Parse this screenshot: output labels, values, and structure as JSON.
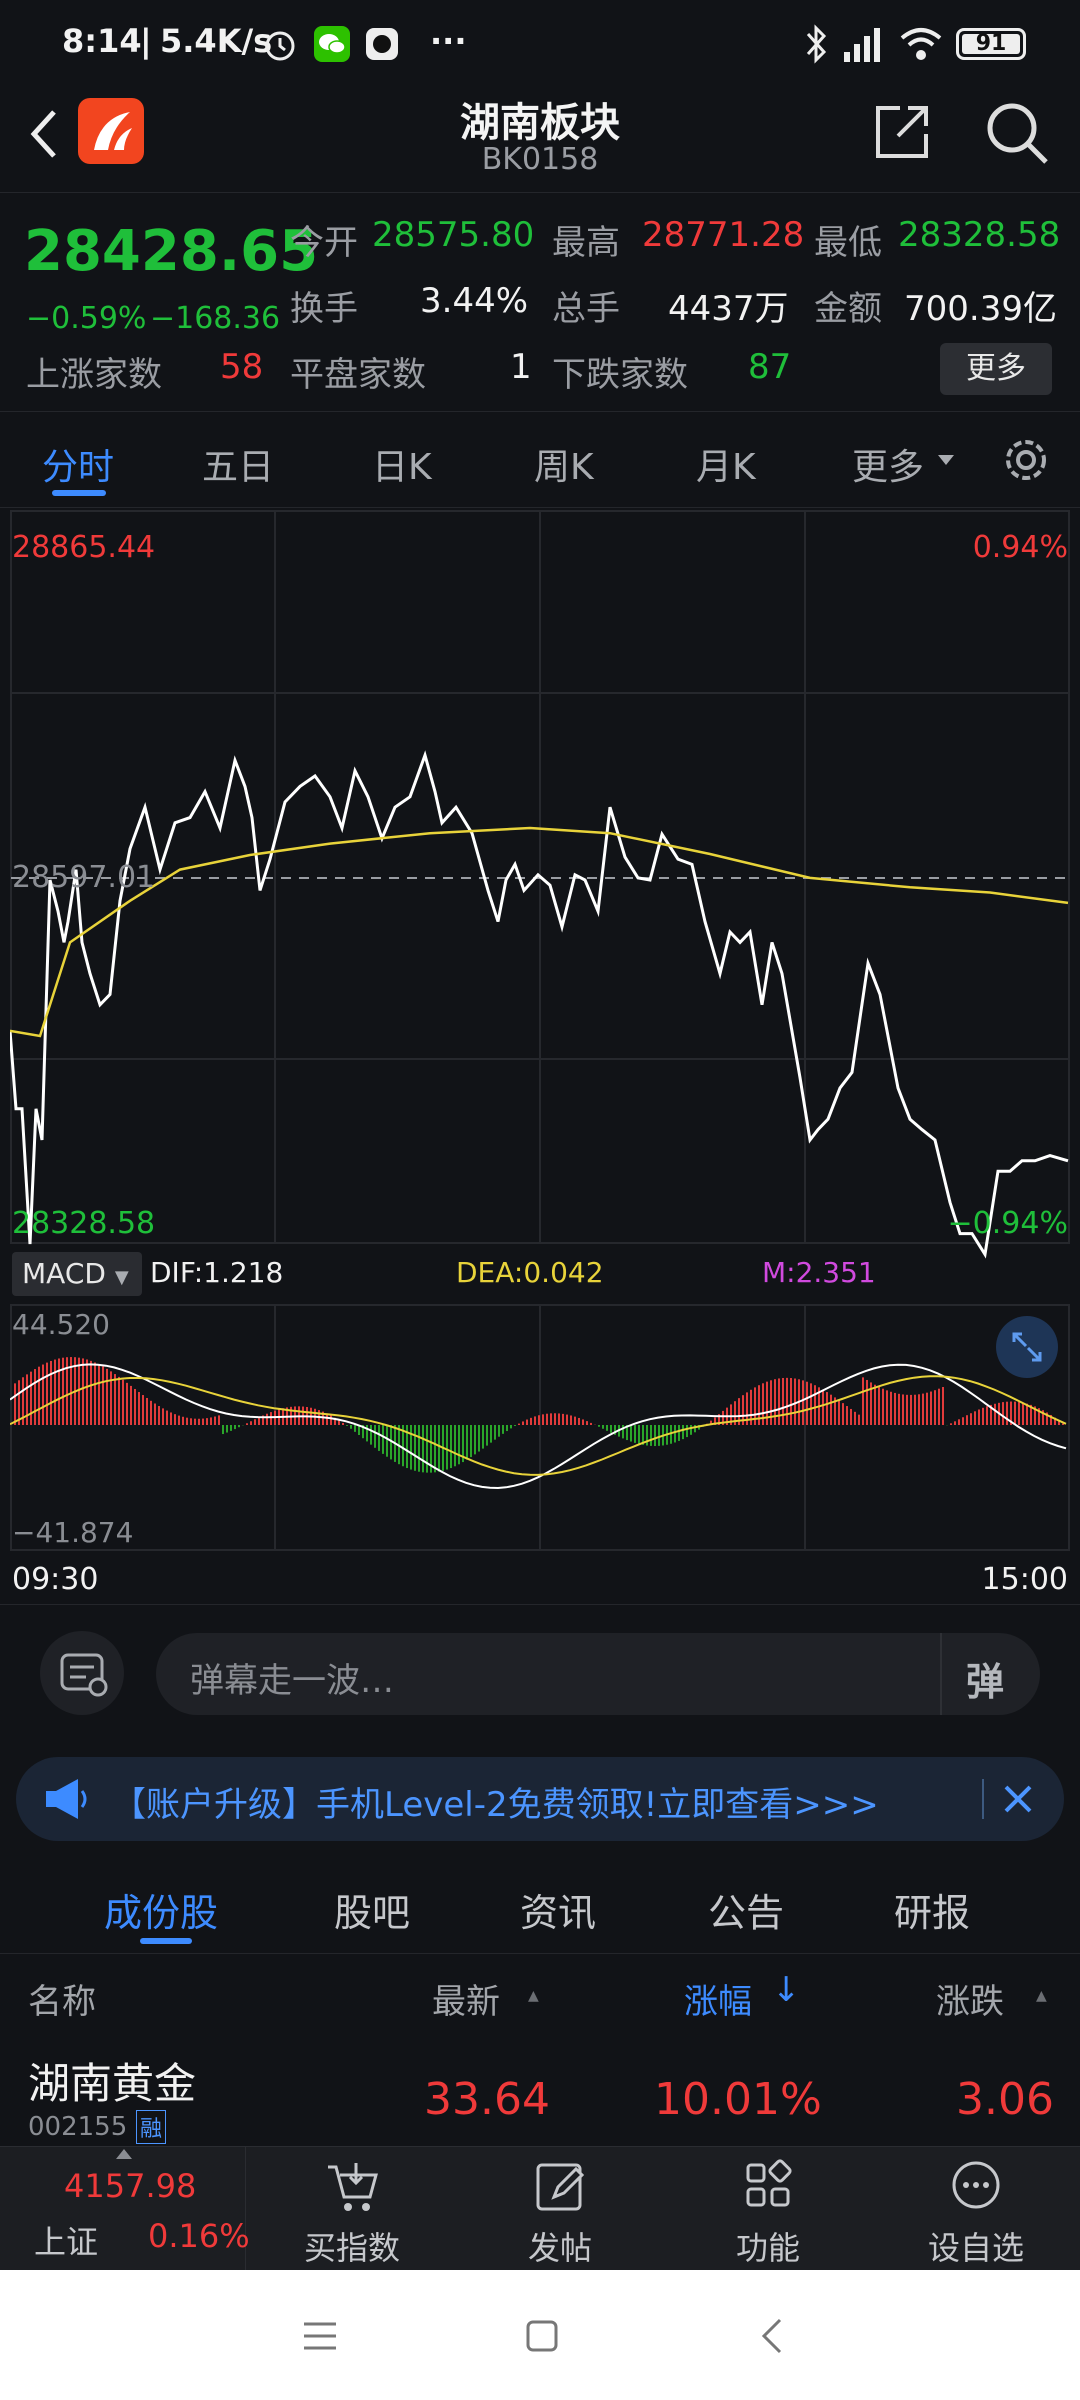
{
  "status": {
    "time": "8:14",
    "speed": "5.4K/s",
    "more": "···",
    "battery": "91"
  },
  "header": {
    "title": "湖南板块",
    "code": "BK0158"
  },
  "quote": {
    "price": "28428.65",
    "change_pct": "−0.59%",
    "change": "−168.36",
    "open_label": "今开",
    "open": "28575.80",
    "high_label": "最高",
    "high": "28771.28",
    "low_label": "最低",
    "low": "28328.58",
    "turnover_label": "换手",
    "turnover": "3.44%",
    "volume_label": "总手",
    "volume": "4437万",
    "amount_label": "金额",
    "amount": "700.39亿",
    "up_label": "上涨家数",
    "up": "58",
    "flat_label": "平盘家数",
    "flat": "1",
    "down_label": "下跌家数",
    "down": "87",
    "more_btn": "更多"
  },
  "tabs": {
    "t1": "分时",
    "t2": "五日",
    "t3": "日K",
    "t4": "周K",
    "t5": "月K",
    "t6": "更多"
  },
  "chart": {
    "top_price": "28865.44",
    "top_pct": "0.94%",
    "mid_price": "28597.01",
    "bottom_price": "28328.58",
    "bottom_pct": "−0.94%",
    "macd_btn": "MACD",
    "dif": "DIF:1.218",
    "dea": "DEA:0.042",
    "m": "M:2.351",
    "macd_top": "44.520",
    "macd_bottom": "−41.874",
    "time_start": "09:30",
    "time_end": "15:00",
    "colors": {
      "price_line": "#ffffff",
      "avg_line": "#e8d33a",
      "up": "#e23b3b",
      "down": "#2aa52a"
    }
  },
  "comment": {
    "placeholder": "弹幕走一波…",
    "danmu_btn": "弹"
  },
  "banner": {
    "text": "【账户升级】手机Level-2免费领取!立即查看>>>"
  },
  "segments": {
    "s1": "成份股",
    "s2": "股吧",
    "s3": "资讯",
    "s4": "公告",
    "s5": "研报"
  },
  "list_header": {
    "name": "名称",
    "latest": "最新",
    "change_pct": "涨幅",
    "change": "涨跌"
  },
  "rows": [
    {
      "name": "湖南黄金",
      "code": "002155",
      "tag": "融",
      "latest": "33.64",
      "change_pct": "10.01%",
      "change": "3.06"
    }
  ],
  "bottom_bar": {
    "index_value": "4157.98",
    "index_name": "上证",
    "index_pct": "0.16%",
    "b1": "买指数",
    "b2": "发帖",
    "b3": "功能",
    "b4": "设自选"
  }
}
